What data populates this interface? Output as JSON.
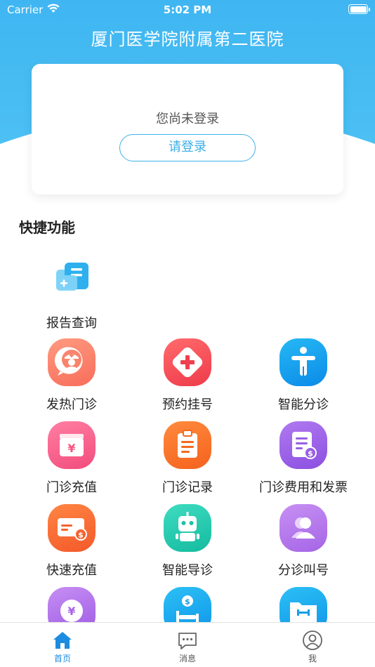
{
  "status_bar": {
    "carrier": "Carrier",
    "time": "5:02 PM"
  },
  "header": {
    "hospital_name": "厦门医学院附属第二医院"
  },
  "login_card": {
    "status_text": "您尚未登录",
    "login_label": "请登录"
  },
  "quick_functions": {
    "title": "快捷功能",
    "items": [
      {
        "label": "报告查询",
        "icon": "report-icon"
      },
      {
        "label": "发热门诊",
        "icon": "fever-clinic-icon"
      },
      {
        "label": "预约挂号",
        "icon": "appointment-icon"
      },
      {
        "label": "智能分诊",
        "icon": "triage-icon"
      },
      {
        "label": "门诊充值",
        "icon": "outpatient-recharge-icon"
      },
      {
        "label": "门诊记录",
        "icon": "clipboard-icon"
      },
      {
        "label": "门诊费用和发票",
        "icon": "invoice-icon"
      },
      {
        "label": "快速充值",
        "icon": "card-recharge-icon"
      },
      {
        "label": "智能导诊",
        "icon": "robot-icon"
      },
      {
        "label": "分诊叫号",
        "icon": "queue-call-icon"
      }
    ]
  },
  "tab_bar": {
    "tabs": [
      {
        "label": "首页",
        "icon": "home-icon",
        "active": true
      },
      {
        "label": "消息",
        "icon": "message-icon",
        "active": false
      },
      {
        "label": "我",
        "icon": "profile-icon",
        "active": false
      }
    ]
  },
  "colors": {
    "header_blue": "#45b9f1",
    "accent_blue": "#1d8ce0"
  }
}
